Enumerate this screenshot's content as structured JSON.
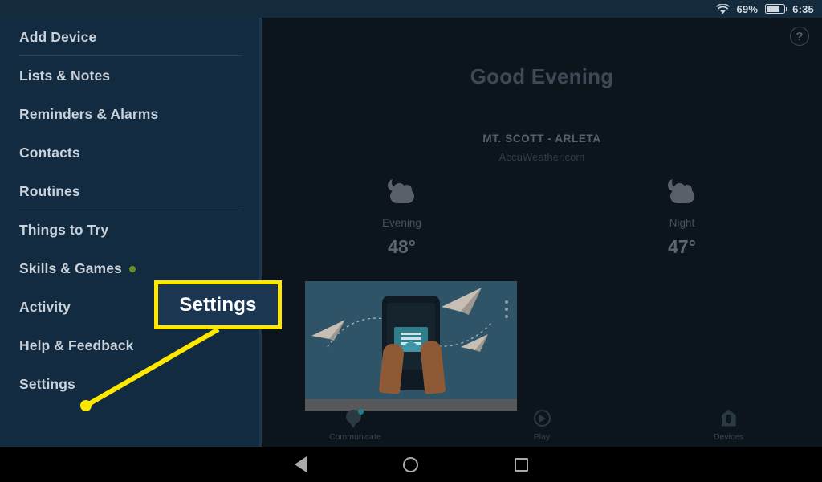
{
  "statusbar": {
    "wifi_icon": "wifi-icon",
    "battery_percent": "69%",
    "battery_icon": "battery-icon",
    "time": "6:35"
  },
  "sidebar": {
    "items": [
      {
        "label": "Add Device",
        "dot": false,
        "divider_after": true
      },
      {
        "label": "Lists & Notes",
        "dot": false,
        "divider_after": false
      },
      {
        "label": "Reminders & Alarms",
        "dot": false,
        "divider_after": false
      },
      {
        "label": "Contacts",
        "dot": false,
        "divider_after": false
      },
      {
        "label": "Routines",
        "dot": false,
        "divider_after": true
      },
      {
        "label": "Things to Try",
        "dot": false,
        "divider_after": false
      },
      {
        "label": "Skills & Games",
        "dot": true,
        "divider_after": false
      },
      {
        "label": "Activity",
        "dot": false,
        "divider_after": false
      },
      {
        "label": "Help & Feedback",
        "dot": false,
        "divider_after": false
      },
      {
        "label": "Settings",
        "dot": false,
        "divider_after": false
      }
    ],
    "notification_dot_color": "#6b8e23"
  },
  "main": {
    "help_icon_label": "?",
    "greeting": "Good Evening",
    "weather": {
      "location": "MT. SCOTT - ARLETA",
      "attribution": "AccuWeather.com",
      "forecast": [
        {
          "period": "Evening",
          "temperature": "48°",
          "icon": "moon-behind-cloud-icon"
        },
        {
          "period": "Night",
          "temperature": "47°",
          "icon": "moon-behind-cloud-icon"
        }
      ]
    },
    "card": {
      "illustration": "hand-holding-phone-with-message-illustration"
    }
  },
  "bottom_nav": {
    "items": [
      {
        "label": "Communicate",
        "icon": "speech-bubble-icon",
        "badge": true
      },
      {
        "label": "Play",
        "icon": "play-circle-icon",
        "badge": false
      },
      {
        "label": "Devices",
        "icon": "device-home-icon",
        "badge": false
      }
    ],
    "badge_color": "#1d7f8e"
  },
  "annotation": {
    "callout_label": "Settings",
    "highlight_color": "#ffe800",
    "pointer_target": "sidebar-item-settings"
  },
  "android_nav": {
    "back_label": "Back",
    "home_label": "Home",
    "recents_label": "Recents"
  }
}
